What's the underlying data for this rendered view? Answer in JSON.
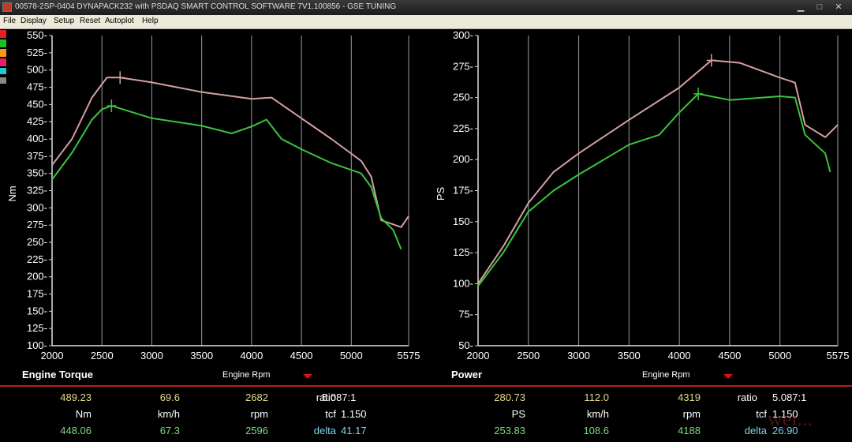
{
  "window": {
    "title": "00578-2SP-0404 DYNAPACK232 with PSDAQ SMART CONTROL SOFTWARE 7V1.100856 - GSE TUNING",
    "controls": {
      "minimize": "▁",
      "maximize": "□",
      "close": "✕"
    }
  },
  "menu": [
    "File",
    "Display",
    "Setup",
    "Reset",
    "Autoplot",
    "Help"
  ],
  "legend_colors": [
    "#e62020",
    "#1fbf1f",
    "#f39c12",
    "#e91e63",
    "#26c6da",
    "#888888"
  ],
  "chart_data": [
    {
      "type": "line",
      "title": "Engine Torque",
      "xlabel": "Engine Rpm",
      "ylabel": "Nm",
      "xlim": [
        2000,
        5575
      ],
      "ylim": [
        100,
        550
      ],
      "xticks": [
        "2000",
        "2500",
        "3000",
        "3500",
        "4000",
        "4500",
        "5000",
        "5575"
      ],
      "yticks": [
        "100",
        "125",
        "150",
        "175",
        "200",
        "225",
        "250",
        "275",
        "300",
        "325",
        "350",
        "375",
        "400",
        "425",
        "450",
        "475",
        "500",
        "525",
        "550"
      ],
      "grid": true,
      "series": [
        {
          "color": "#d4a0a0",
          "x": [
            2000,
            2200,
            2400,
            2550,
            2682,
            3000,
            3500,
            4000,
            4200,
            4400,
            4800,
            5100,
            5200,
            5300,
            5500,
            5575
          ],
          "y": [
            362,
            400,
            460,
            489,
            489,
            482,
            468,
            458,
            460,
            440,
            400,
            368,
            345,
            282,
            272,
            288
          ],
          "marker": {
            "x": 2682,
            "y": 489
          }
        },
        {
          "color": "#3cc43c",
          "x": [
            2000,
            2200,
            2400,
            2500,
            2596,
            3000,
            3500,
            3800,
            4000,
            4150,
            4300,
            4500,
            4800,
            5100,
            5200,
            5300,
            5420,
            5500
          ],
          "y": [
            341,
            380,
            428,
            443,
            448,
            430,
            419,
            408,
            418,
            428,
            400,
            385,
            365,
            350,
            330,
            285,
            268,
            240
          ],
          "marker": {
            "x": 2596,
            "y": 448
          }
        }
      ]
    },
    {
      "type": "line",
      "title": "Power",
      "xlabel": "Engine Rpm",
      "ylabel": "PS",
      "xlim": [
        2000,
        5575
      ],
      "ylim": [
        50,
        300
      ],
      "xticks": [
        "2000",
        "2500",
        "3000",
        "3500",
        "4000",
        "4500",
        "5000",
        "5575"
      ],
      "yticks": [
        "50",
        "75",
        "100",
        "125",
        "150",
        "175",
        "200",
        "225",
        "250",
        "275",
        "300"
      ],
      "grid": true,
      "series": [
        {
          "color": "#d4a0a0",
          "x": [
            2000,
            2250,
            2500,
            2750,
            3000,
            3500,
            4000,
            4319,
            4600,
            5000,
            5150,
            5250,
            5450,
            5575
          ],
          "y": [
            100,
            130,
            165,
            190,
            205,
            232,
            258,
            280,
            278,
            266,
            262,
            228,
            218,
            228
          ],
          "marker": {
            "x": 4319,
            "y": 280
          }
        },
        {
          "color": "#3cc43c",
          "x": [
            2000,
            2250,
            2500,
            2750,
            3000,
            3500,
            3800,
            4000,
            4188,
            4500,
            5000,
            5150,
            5250,
            5450,
            5500
          ],
          "y": [
            98,
            125,
            158,
            175,
            188,
            212,
            220,
            238,
            253,
            248,
            251,
            250,
            220,
            205,
            190
          ],
          "marker": {
            "x": 4188,
            "y": 253
          }
        }
      ]
    }
  ],
  "panels": {
    "left": {
      "header": "Engine Torque",
      "axis_label": "Engine Rpm",
      "row1": [
        "489.23",
        "69.6",
        "2682"
      ],
      "row2": [
        "Nm",
        "km/h",
        "rpm"
      ],
      "row3": [
        "448.06",
        "67.3",
        "2596"
      ],
      "ratio_label": "ratio",
      "ratio_value": "5.087:1",
      "tcf_label": "tcf",
      "tcf_value": "1.150",
      "delta_label": "delta",
      "delta_value": "41.17"
    },
    "right": {
      "header": "Power",
      "axis_label": "Engine Rpm",
      "row1": [
        "280.73",
        "112.0",
        "4319"
      ],
      "row2": [
        "PS",
        "km/h",
        "rpm"
      ],
      "row3": [
        "253.83",
        "108.6",
        "4188"
      ],
      "ratio_label": "ratio",
      "ratio_value": "5.087:1",
      "tcf_label": "tcf",
      "tcf_value": "1.150",
      "delta_label": "delta",
      "delta_value": "26.90"
    }
  },
  "watermark": "wei..."
}
